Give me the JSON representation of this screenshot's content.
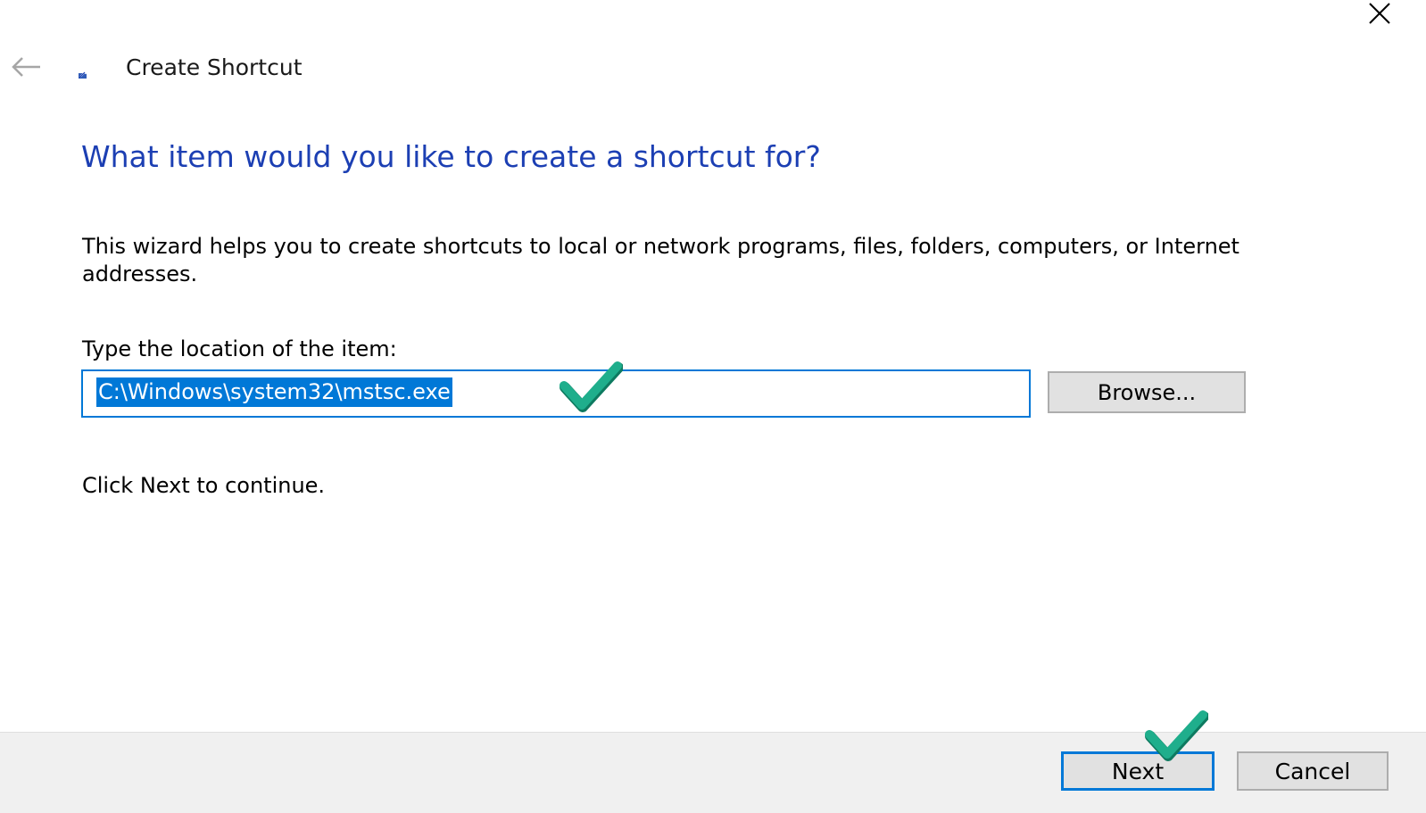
{
  "window": {
    "title": "Create Shortcut"
  },
  "main": {
    "heading": "What item would you like to create a shortcut for?",
    "description": "This wizard helps you to create shortcuts to local or network programs, files, folders, computers, or Internet addresses.",
    "location_label": "Type the location of the item:",
    "location_value": "C:\\Windows\\system32\\mstsc.exe",
    "browse_label": "Browse...",
    "hint": "Click Next to continue."
  },
  "footer": {
    "next_label": "Next",
    "cancel_label": "Cancel"
  },
  "icons": {
    "close": "close-icon",
    "back": "back-arrow-icon",
    "app": "shortcut-icon",
    "annotation": "checkmark-icon"
  },
  "colors": {
    "heading": "#1c3fb3",
    "accent": "#0078d7",
    "footer_bg": "#f0f0f0",
    "button_bg": "#e1e1e1",
    "checkmark": "#1fae8c"
  }
}
